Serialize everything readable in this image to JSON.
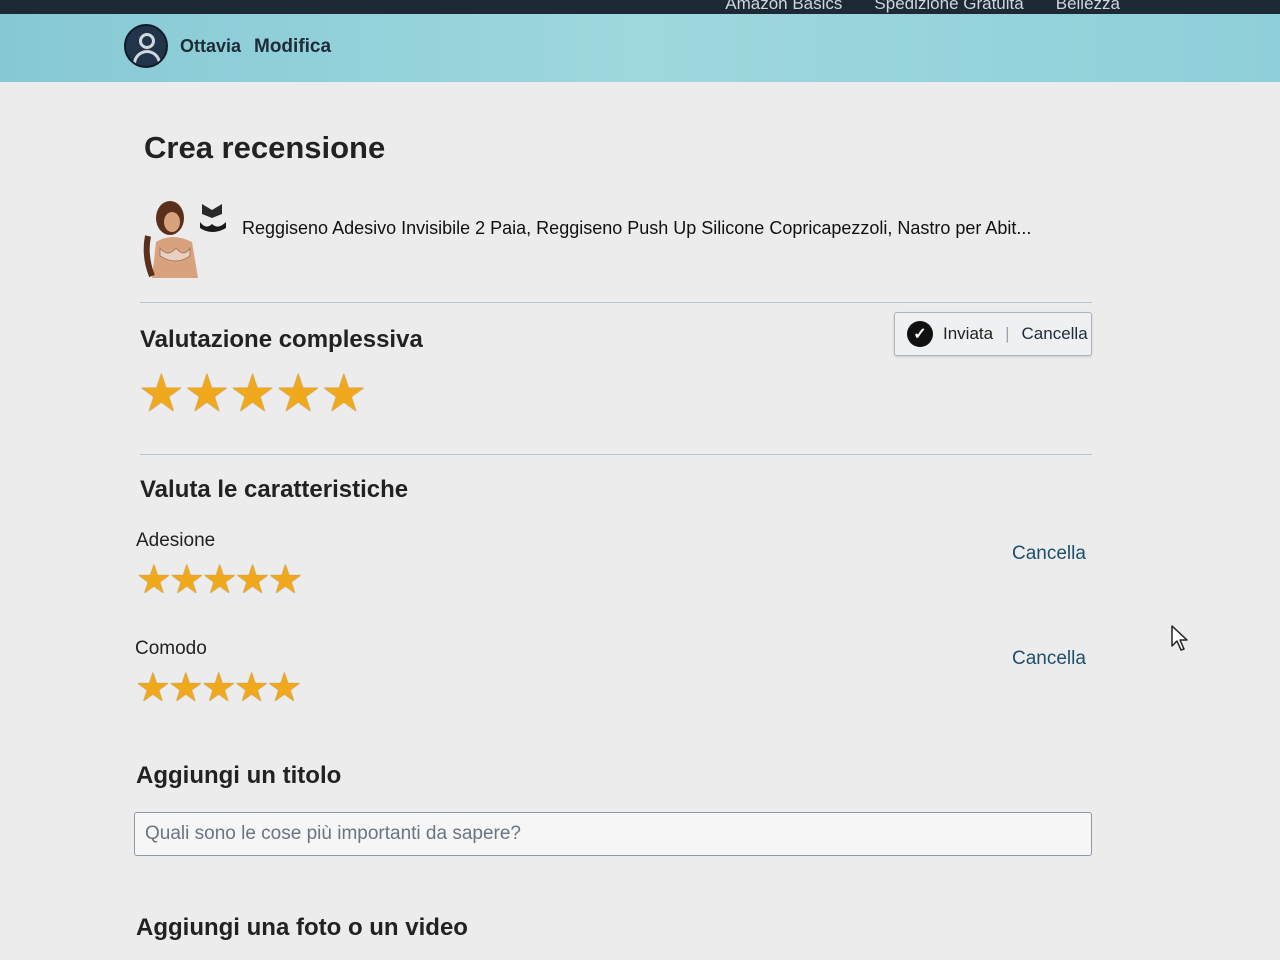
{
  "top_nav": {
    "links": [
      "Amazon Basics",
      "Spedizione Gratuita",
      "Bellezza"
    ]
  },
  "user_bar": {
    "name": "Ottavia",
    "edit_label": "Modifica"
  },
  "page": {
    "title": "Crea recensione"
  },
  "product": {
    "title": "Reggiseno Adesivo Invisibile 2 Paia, Reggiseno Push Up Silicone Copricapezzoli, Nastro per Abit..."
  },
  "overall_rating": {
    "heading": "Valutazione complessiva",
    "stars": 5,
    "max_stars": 5,
    "status_label": "Inviata",
    "cancel_label": "Cancella"
  },
  "features": {
    "heading": "Valuta le caratteristiche",
    "items": [
      {
        "label": "Adesione",
        "stars": 5,
        "cancel_label": "Cancella"
      },
      {
        "label": "Comodo",
        "stars": 5,
        "cancel_label": "Cancella"
      }
    ]
  },
  "title_section": {
    "heading": "Aggiungi un titolo",
    "placeholder": "Quali sono le cose più importanti da sapere?"
  },
  "media_section": {
    "heading": "Aggiungi una foto o un video"
  },
  "icons": {
    "check": "check-circle-icon",
    "star": "star-icon",
    "avatar": "user-avatar-icon",
    "cursor": "mouse-pointer-icon"
  },
  "colors": {
    "star": "#f0a81c",
    "link": "#1d4f6b",
    "header_bg": "#8fcfd9"
  }
}
